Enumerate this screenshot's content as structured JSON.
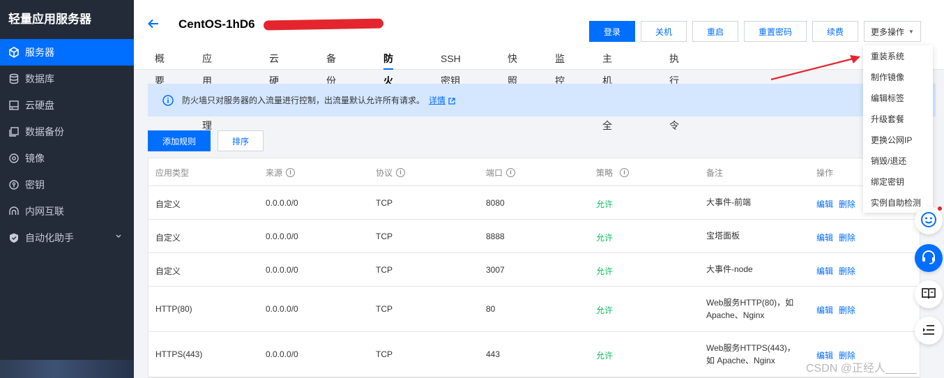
{
  "sidebar": {
    "brand": "轻量应用服务器",
    "items": [
      {
        "label": "服务器",
        "icon": "server-icon",
        "active": true
      },
      {
        "label": "数据库",
        "icon": "database-icon"
      },
      {
        "label": "云硬盘",
        "icon": "disk-icon"
      },
      {
        "label": "数据备份",
        "icon": "backup-icon"
      },
      {
        "label": "镜像",
        "icon": "image-icon"
      },
      {
        "label": "密钥",
        "icon": "key-icon"
      },
      {
        "label": "内网互联",
        "icon": "network-icon"
      },
      {
        "label": "自动化助手",
        "icon": "automation-icon",
        "expandable": true
      }
    ]
  },
  "header": {
    "title": "CentOS-1hD6",
    "buttons": {
      "login": "登录",
      "shutdown": "关机",
      "restart": "重启",
      "reset_password": "重置密码",
      "renew": "续费",
      "more": "更多操作"
    },
    "tabs": [
      "概要",
      "应用管理",
      "云硬盘",
      "备份点",
      "防火墙",
      "SSH密钥",
      "快照",
      "监控",
      "主机安全",
      "执行命令"
    ],
    "active_tab": "防火墙"
  },
  "info_bar": {
    "text": "防火墙只对服务器的入流量进行控制，出流量默认允许所有请求。",
    "link": "详情"
  },
  "actions": {
    "add_rule": "添加规则",
    "sort": "排序"
  },
  "table": {
    "headers": {
      "type": "应用类型",
      "source": "来源",
      "protocol": "协议",
      "port": "端口",
      "policy": "策略",
      "note": "备注",
      "ops": "操作"
    },
    "rows": [
      {
        "type": "自定义",
        "source": "0.0.0.0/0",
        "protocol": "TCP",
        "port": "8080",
        "policy": "允许",
        "note": "大事件-前端",
        "note2": "",
        "edit": "编辑",
        "delete": "删除"
      },
      {
        "type": "自定义",
        "source": "0.0.0.0/0",
        "protocol": "TCP",
        "port": "8888",
        "policy": "允许",
        "note": "宝塔面板",
        "note2": "",
        "edit": "编辑",
        "delete": "删除"
      },
      {
        "type": "自定义",
        "source": "0.0.0.0/0",
        "protocol": "TCP",
        "port": "3007",
        "policy": "允许",
        "note": "大事件-node",
        "note2": "",
        "edit": "编辑",
        "delete": "删除"
      },
      {
        "type": "HTTP(80)",
        "source": "0.0.0.0/0",
        "protocol": "TCP",
        "port": "80",
        "policy": "允许",
        "note": "Web服务HTTP(80)，如",
        "note2": "Apache、Nginx",
        "edit": "编辑",
        "delete": "删除"
      },
      {
        "type": "HTTPS(443)",
        "source": "0.0.0.0/0",
        "protocol": "TCP",
        "port": "443",
        "policy": "允许",
        "note": "Web服务HTTPS(443)，",
        "note2": "如 Apache、Nginx",
        "edit": "编辑",
        "delete": "删除"
      }
    ]
  },
  "dropdown": {
    "items": [
      "重装系统",
      "制作镜像",
      "编辑标签",
      "升级套餐",
      "更换公网IP",
      "销毁/退还",
      "绑定密钥",
      "实例自助检测"
    ]
  },
  "floating_buttons": [
    "smile-icon",
    "headset-icon",
    "book-icon",
    "list-icon"
  ],
  "watermark": "CSDN @正经人_____",
  "colors": {
    "primary": "#006eff",
    "sidebar_bg": "#232b38",
    "success": "#0abf5b",
    "annotation": "#e5252e",
    "info_bg": "#d5e7ff"
  }
}
